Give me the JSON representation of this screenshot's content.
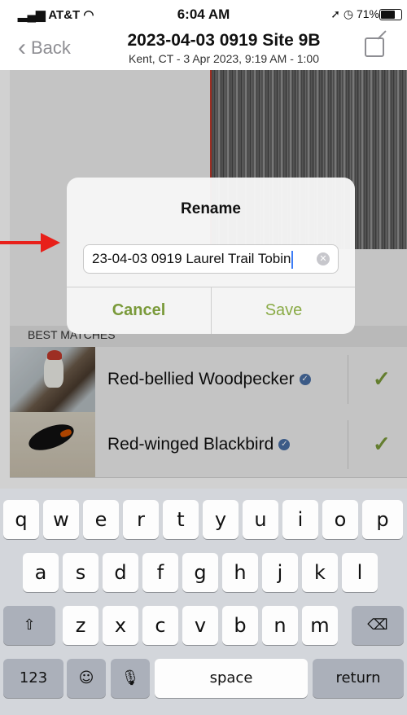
{
  "status": {
    "carrier": "AT&T",
    "time": "6:04 AM",
    "battery": "71%"
  },
  "nav": {
    "back_label": "Back",
    "title": "2023-04-03 0919 Site 9B",
    "subtitle": "Kent, CT - 3 Apr 2023, 9:19 AM - 1:00"
  },
  "best_matches": {
    "header": "BEST MATCHES",
    "items": [
      {
        "name": "Red-bellied Woodpecker"
      },
      {
        "name": "Red-winged Blackbird"
      }
    ]
  },
  "dialog": {
    "title": "Rename",
    "input_value": "23-04-03 0919 Laurel Trail Tobin",
    "cancel_label": "Cancel",
    "save_label": "Save"
  },
  "keyboard": {
    "row1": [
      "q",
      "w",
      "e",
      "r",
      "t",
      "y",
      "u",
      "i",
      "o",
      "p"
    ],
    "row2": [
      "a",
      "s",
      "d",
      "f",
      "g",
      "h",
      "j",
      "k",
      "l"
    ],
    "row3": [
      "z",
      "x",
      "c",
      "v",
      "b",
      "n",
      "m"
    ],
    "numbers_label": "123",
    "space_label": "space",
    "return_label": "return"
  },
  "colors": {
    "accent_green": "#7a9a3a",
    "annotation_arrow": "#e8201a",
    "caret": "#3d7cf5"
  }
}
